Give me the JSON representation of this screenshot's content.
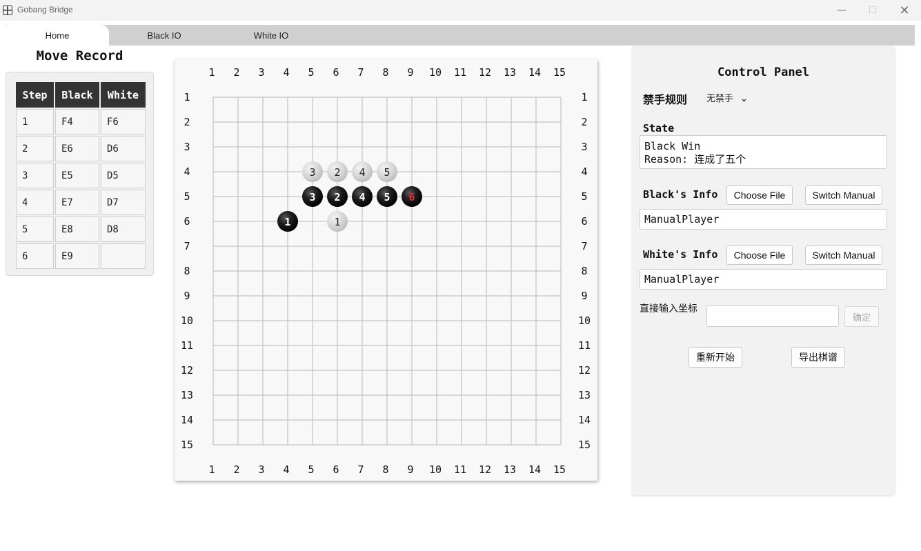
{
  "window": {
    "title": "Gobang Bridge",
    "controls": {
      "minimize": "—",
      "maximize": "☐",
      "close": "✕"
    }
  },
  "tabs": [
    {
      "label": "Home",
      "active": true
    },
    {
      "label": "Black IO",
      "active": false
    },
    {
      "label": "White IO",
      "active": false
    }
  ],
  "move_record": {
    "title": "Move Record",
    "headers": [
      "Step",
      "Black",
      "White"
    ],
    "rows": [
      [
        "1",
        "F4",
        "F6"
      ],
      [
        "2",
        "E6",
        "D6"
      ],
      [
        "3",
        "E5",
        "D5"
      ],
      [
        "4",
        "E7",
        "D7"
      ],
      [
        "5",
        "E8",
        "D8"
      ],
      [
        "6",
        "E9",
        ""
      ]
    ]
  },
  "board": {
    "size": 15,
    "column_labels": [
      "1",
      "2",
      "3",
      "4",
      "5",
      "6",
      "7",
      "8",
      "9",
      "10",
      "11",
      "12",
      "13",
      "14",
      "15"
    ],
    "row_labels": [
      "1",
      "2",
      "3",
      "4",
      "5",
      "6",
      "7",
      "8",
      "9",
      "10",
      "11",
      "12",
      "13",
      "14",
      "15"
    ],
    "stones": [
      {
        "color": "black",
        "label": "1",
        "col": 4,
        "row": 6
      },
      {
        "color": "black",
        "label": "2",
        "col": 6,
        "row": 5
      },
      {
        "color": "black",
        "label": "3",
        "col": 5,
        "row": 5
      },
      {
        "color": "black",
        "label": "4",
        "col": 7,
        "row": 5
      },
      {
        "color": "black",
        "label": "5",
        "col": 8,
        "row": 5
      },
      {
        "color": "black",
        "label": "6",
        "col": 9,
        "row": 5,
        "last": true
      },
      {
        "color": "white",
        "label": "1",
        "col": 6,
        "row": 6
      },
      {
        "color": "white",
        "label": "2",
        "col": 6,
        "row": 4
      },
      {
        "color": "white",
        "label": "3",
        "col": 5,
        "row": 4
      },
      {
        "color": "white",
        "label": "4",
        "col": 7,
        "row": 4
      },
      {
        "color": "white",
        "label": "5",
        "col": 8,
        "row": 4
      }
    ],
    "colors": {
      "last_move_label": "#e03030"
    }
  },
  "control_panel": {
    "title": "Control Panel",
    "rule_label": "禁手规则",
    "rule_value": "无禁手",
    "state_label": "State",
    "state_text": "Black Win\nReason: 连成了五个",
    "black_info_label": "Black's Info",
    "white_info_label": "White's Info",
    "choose_file": "Choose File",
    "switch_manual": "Switch Manual",
    "black_player": "ManualPlayer",
    "white_player": "ManualPlayer",
    "coord_label": "直接输入坐标",
    "coord_value": "",
    "confirm": "确定",
    "restart": "重新开始",
    "export": "导出棋谱"
  }
}
